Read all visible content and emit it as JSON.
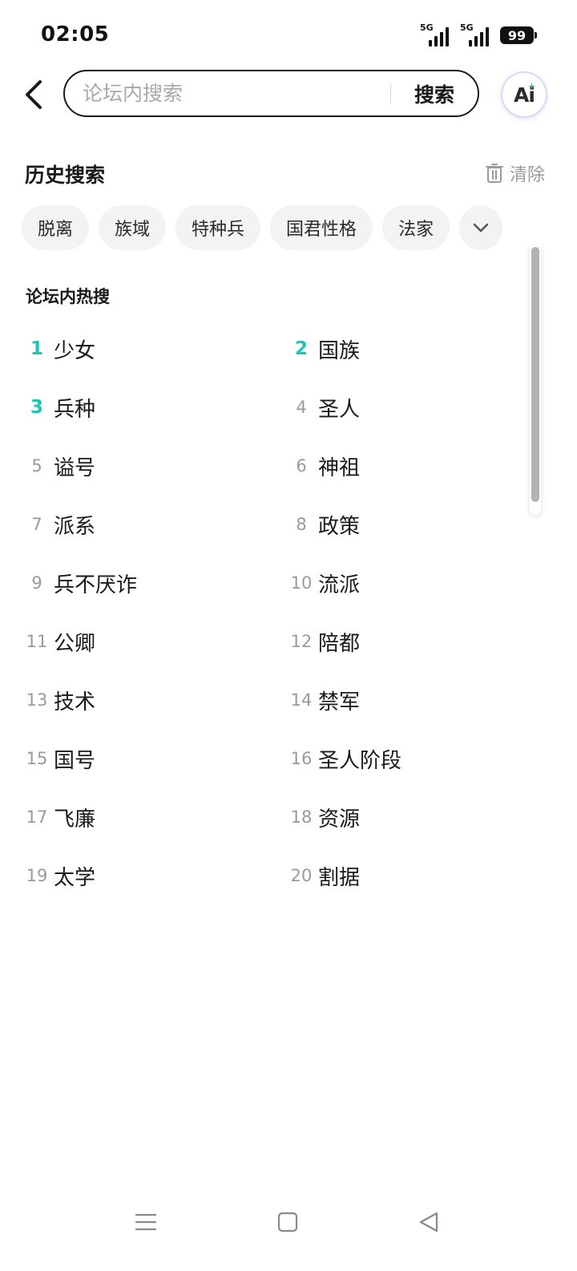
{
  "status_bar": {
    "time": "02:05",
    "signal_1_label": "5G",
    "signal_2_label": "5G",
    "battery_level": "99"
  },
  "search": {
    "placeholder": "论坛内搜索",
    "submit_label": "搜索",
    "ai_label": "Ai"
  },
  "history": {
    "title": "历史搜索",
    "clear_label": "清除",
    "items": [
      "脱离",
      "族域",
      "特种兵",
      "国君性格",
      "法家"
    ]
  },
  "hot": {
    "title": "论坛内热搜",
    "items": [
      {
        "rank": "1",
        "text": "少女"
      },
      {
        "rank": "2",
        "text": "国族"
      },
      {
        "rank": "3",
        "text": "兵种"
      },
      {
        "rank": "4",
        "text": "圣人"
      },
      {
        "rank": "5",
        "text": "谥号"
      },
      {
        "rank": "6",
        "text": "神祖"
      },
      {
        "rank": "7",
        "text": "派系"
      },
      {
        "rank": "8",
        "text": "政策"
      },
      {
        "rank": "9",
        "text": "兵不厌诈"
      },
      {
        "rank": "10",
        "text": "流派"
      },
      {
        "rank": "11",
        "text": "公卿"
      },
      {
        "rank": "12",
        "text": "陪都"
      },
      {
        "rank": "13",
        "text": "技术"
      },
      {
        "rank": "14",
        "text": "禁军"
      },
      {
        "rank": "15",
        "text": "国号"
      },
      {
        "rank": "16",
        "text": "圣人阶段"
      },
      {
        "rank": "17",
        "text": "飞廉"
      },
      {
        "rank": "18",
        "text": "资源"
      },
      {
        "rank": "19",
        "text": "太学"
      },
      {
        "rank": "20",
        "text": "割据"
      }
    ]
  },
  "colors": {
    "accent_rank": "#15c9b5",
    "text_primary": "#1a1a1a",
    "text_secondary": "#9a9a9a",
    "chip_bg": "#f3f3f3"
  },
  "icons": {
    "back": "back-arrow-icon",
    "trash": "trash-icon",
    "expand": "chevron-down-icon",
    "ai_sparkle": "sparkle-icon",
    "nav_menu": "menu-lines-icon",
    "nav_home": "home-square-icon",
    "nav_back": "back-triangle-icon"
  }
}
